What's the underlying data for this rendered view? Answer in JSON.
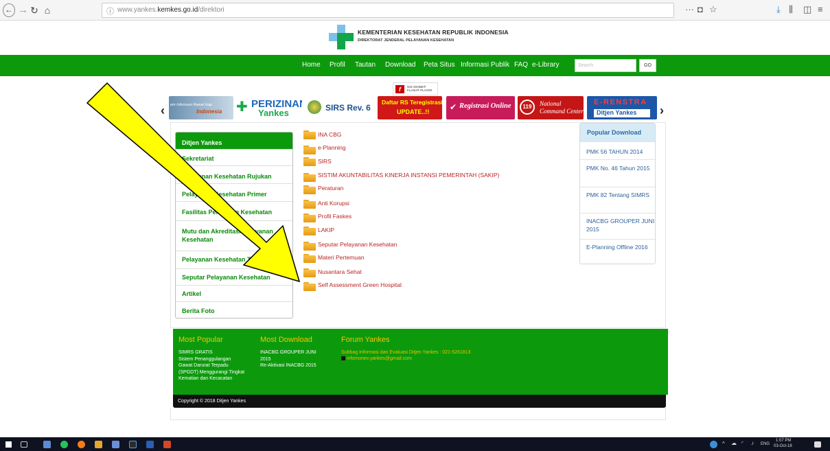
{
  "browser": {
    "url_prefix": "www.yankes.",
    "url_domain": "kemkes.go.id",
    "url_path": "/direktori",
    "back_icon": "back-arrow-icon",
    "forward_icon": "forward-arrow-icon",
    "reload_icon": "reload-icon",
    "home_icon": "home-icon"
  },
  "header": {
    "title": "KEMENTERIAN KESEHATAN REPUBLIK INDONESIA",
    "subtitle": "DIREKTORAT JENDERAL PELAYANAN KESEHATAN"
  },
  "nav": {
    "items": [
      "Home",
      "Profil",
      "Tautan",
      "Download",
      "Peta Situs",
      "Informasi Publik",
      "FAQ",
      "e-Library"
    ],
    "search_placeholder": "Search",
    "go_label": "GO"
  },
  "flash": {
    "line1": "Get ADOBE®",
    "line2": "FLASH® PLAYER"
  },
  "banners": {
    "b1_line1": "em Informasi Rawat Inap",
    "b1_line2": "Indonesia",
    "b2_line1": "PERIZINAN",
    "b2_line2": "Yankes",
    "b3": "SIRS Rev. 6",
    "b4_line1": "Daftar RS Teregistrasi",
    "b4_line2": "UPDATE..!!",
    "b5": "Registrasi Online",
    "b6_num": "119",
    "b6_line1": "National",
    "b6_line2": "Command Center",
    "b7_line1": "E-RENSTRA",
    "b7_line2": "Ditjen Yankes"
  },
  "sidebar": {
    "items": [
      "Ditjen Yankes",
      "Sekretariat",
      "Pelayanan Kesehatan Rujukan",
      "Pelayanan Kesehatan Primer",
      "Fasilitas Pelayanan Kesehatan",
      "Mutu dan Akreditasi Pelayanan Kesehatan",
      "Pelayanan Kesehatan Tradisional",
      "Seputar Pelayanan Kesehatan",
      "Artikel",
      "Berita Foto"
    ]
  },
  "directory": {
    "folders": [
      "INA CBG",
      "e-Planning",
      "SIRS",
      "SISTIM AKUNTABILITAS KINERJA INSTANSI PEMERINTAH (SAKIP)",
      "Peraturan",
      "Anti Korupsi",
      "Profil Faskes",
      "LAKIP",
      "Seputar Pelayanan Kesehatan",
      "Materi Pertemuan",
      "Nusantara Sehat",
      "Self Assessment Green Hospital"
    ]
  },
  "popular": {
    "heading": "Popular Download",
    "items": [
      "PMK 56 TAHUN 2014",
      "PMK No. 46 Tahun 2015",
      "PMK 82 Tentang SIMRS",
      "INACBG GROUPER JUNI 2015",
      "E-Planning Offline 2016"
    ]
  },
  "footer": {
    "most_popular": "Most Popular",
    "most_popular_text": "SIMRS GRATIS\nSistem Penanggulangan\nGawat Darurat Terpadu\n(SPGDT) Menggurangi Tingkat\nKematian dan Kecacatan",
    "most_download": "Most Download",
    "most_download_text": "INACBG GROUPER JUNI\n2015\nRe-Aktivasi INACBG 2015",
    "forum": "Forum Yankes",
    "forum_text": "Subbag Informasi dan Evaluasi Ditjen Yankes : 021-5261813",
    "forum_email": "infomonev.yankes@gmail.com",
    "copyright": "Copyright © 2018 Ditjen Yankes"
  },
  "taskbar": {
    "language": "ENG",
    "time": "1:07 PM",
    "date": "03-Oct-18"
  },
  "colors": {
    "brand_green": "#0c9a0c",
    "link_red": "#b22222",
    "popular_blue": "#2d5f9a",
    "arrow_yellow": "#ffff00"
  }
}
